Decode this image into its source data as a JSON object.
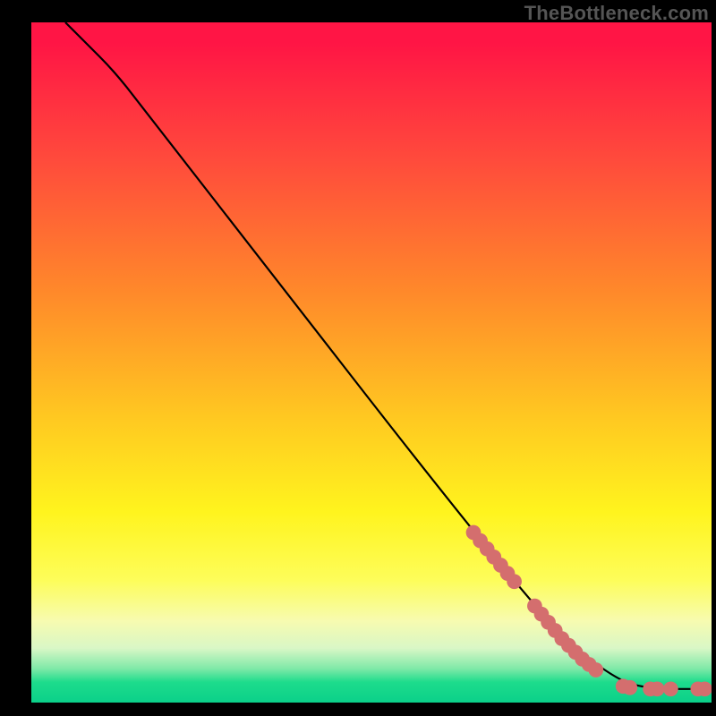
{
  "watermark": "TheBottleneck.com",
  "chart_data": {
    "type": "line",
    "title": "",
    "xlabel": "",
    "ylabel": "",
    "xlim": [
      0,
      100
    ],
    "ylim": [
      0,
      100
    ],
    "grid": false,
    "legend": false,
    "curve": [
      {
        "x": 5,
        "y": 100
      },
      {
        "x": 8,
        "y": 97
      },
      {
        "x": 12,
        "y": 93
      },
      {
        "x": 16,
        "y": 88
      },
      {
        "x": 75,
        "y": 12
      },
      {
        "x": 85,
        "y": 4
      },
      {
        "x": 90,
        "y": 2
      },
      {
        "x": 100,
        "y": 2
      }
    ],
    "markers": [
      {
        "x": 65,
        "y": 25
      },
      {
        "x": 66,
        "y": 23.8
      },
      {
        "x": 67,
        "y": 22.6
      },
      {
        "x": 68,
        "y": 21.4
      },
      {
        "x": 69,
        "y": 20.2
      },
      {
        "x": 70,
        "y": 19.0
      },
      {
        "x": 71,
        "y": 17.8
      },
      {
        "x": 74,
        "y": 14.2
      },
      {
        "x": 75,
        "y": 13.0
      },
      {
        "x": 76,
        "y": 11.8
      },
      {
        "x": 77,
        "y": 10.6
      },
      {
        "x": 78,
        "y": 9.4
      },
      {
        "x": 79,
        "y": 8.4
      },
      {
        "x": 80,
        "y": 7.4
      },
      {
        "x": 81,
        "y": 6.4
      },
      {
        "x": 82,
        "y": 5.6
      },
      {
        "x": 83,
        "y": 4.8
      },
      {
        "x": 87,
        "y": 2.4
      },
      {
        "x": 88,
        "y": 2.2
      },
      {
        "x": 91,
        "y": 2.0
      },
      {
        "x": 92,
        "y": 2.0
      },
      {
        "x": 94,
        "y": 2.0
      },
      {
        "x": 98,
        "y": 2.0
      },
      {
        "x": 99,
        "y": 2.0
      }
    ],
    "marker_radius": 1.1,
    "colors": {
      "line": "#000000",
      "marker": "#d46e6e",
      "gradient_top": "#ff1545",
      "gradient_bottom": "#0bd089"
    }
  }
}
